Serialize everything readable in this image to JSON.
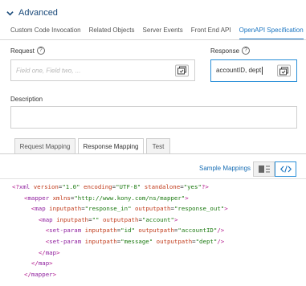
{
  "section": {
    "title": "Advanced"
  },
  "tabs": [
    {
      "label": "Custom Code Invocation"
    },
    {
      "label": "Related Objects"
    },
    {
      "label": "Server Events"
    },
    {
      "label": "Front End API"
    },
    {
      "label": "OpenAPI Specification",
      "active": true
    }
  ],
  "request": {
    "label": "Request",
    "placeholder": "Field one, Field two, ..."
  },
  "response": {
    "label": "Response",
    "value": "accountID, dept"
  },
  "description": {
    "label": "Description",
    "value": ""
  },
  "mapping_tabs": [
    {
      "label": "Request Mapping"
    },
    {
      "label": "Response Mapping",
      "active": true
    },
    {
      "label": "Test"
    }
  ],
  "sample_mappings": "Sample Mappings",
  "code": [
    "<?xml version=\"1.0\" encoding=\"UTF-8\" standalone=\"yes\"?>",
    "<mapper xmlns=\"http://www.kony.com/ns/mapper\">",
    "  <map inputpath=\"response_in\" outputpath=\"response_out\">",
    "    <map inputpath=\"\" outputpath=\"account\">",
    "      <set-param inputpath=\"id\" outputpath=\"accountID\"/>",
    "      <set-param inputpath=\"message\" outputpath=\"dept\"/>",
    "    </map>",
    "  </map>",
    "</mapper>"
  ],
  "colors": {
    "accent": "#1b76c2",
    "focus_border": "#2a8fd8"
  }
}
